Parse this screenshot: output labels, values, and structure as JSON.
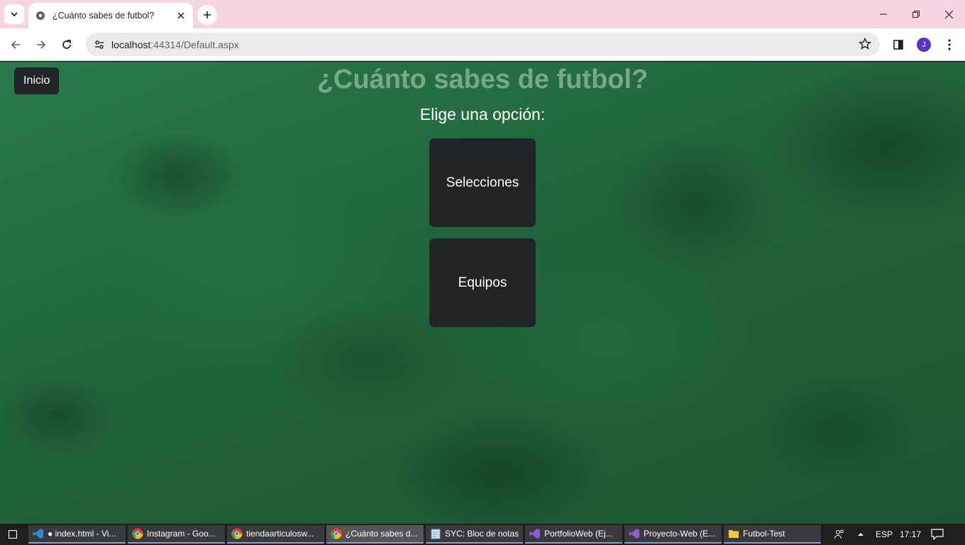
{
  "browser": {
    "tab_title": "¿Cuánto sabes de futbol?",
    "url_host": "localhost",
    "url_path": ":44314/Default.aspx",
    "avatar_letter": "J"
  },
  "page": {
    "nav_inicio": "Inicio",
    "title": "¿Cuánto sabes de futbol?",
    "subtitle": "Elige una opción:",
    "options": [
      "Selecciones",
      "Equipos"
    ],
    "colors": {
      "button_bg": "#212529",
      "title": "#77a88c",
      "background": "#1f6038"
    }
  },
  "taskbar": {
    "items": [
      {
        "label": "● index.html - Vi...",
        "icon": "vscode-icon"
      },
      {
        "label": "Instagram - Goo...",
        "icon": "chrome-icon"
      },
      {
        "label": "tiendaarticulosw...",
        "icon": "chrome-icon"
      },
      {
        "label": "¿Cuánto sabes d...",
        "icon": "chrome-icon"
      },
      {
        "label": "SYC: Bloc de notas",
        "icon": "notepad-icon"
      },
      {
        "label": "PortfolioWeb (Ej...",
        "icon": "visual-studio-icon"
      },
      {
        "label": "Proyecto-Web (E...",
        "icon": "visual-studio-icon"
      },
      {
        "label": "Futbol-Test",
        "icon": "folder-icon"
      }
    ],
    "language": "ESP",
    "time": "17:17"
  }
}
